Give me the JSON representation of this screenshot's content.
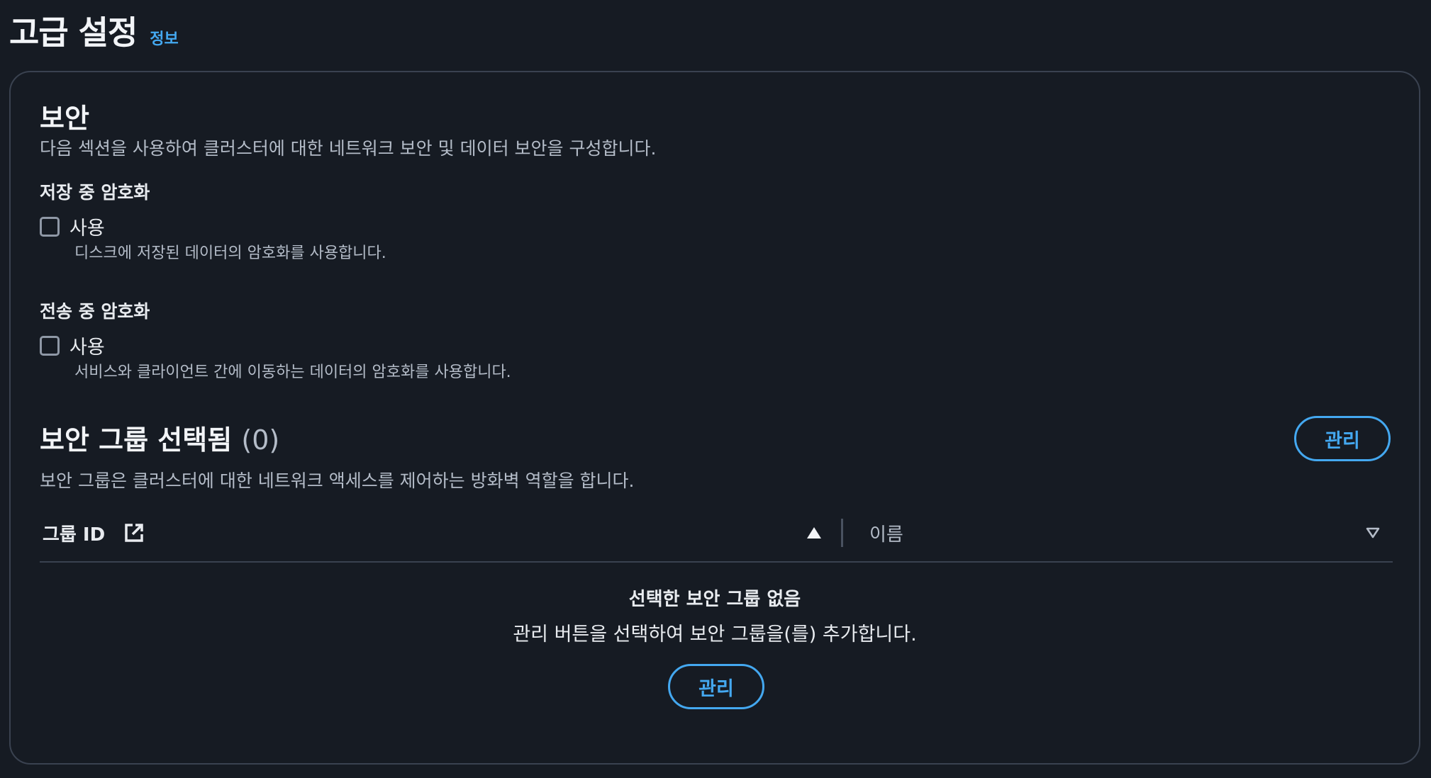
{
  "header": {
    "title": "고급 설정",
    "info_link": "정보"
  },
  "security": {
    "title": "보안",
    "description": "다음 섹션을 사용하여 클러스터에 대한 네트워크 보안 및 데이터 보안을 구성합니다.",
    "encryption_at_rest": {
      "label": "저장 중 암호화",
      "checkbox_label": "사용",
      "checked": false,
      "description": "디스크에 저장된 데이터의 암호화를 사용합니다."
    },
    "encryption_in_transit": {
      "label": "전송 중 암호화",
      "checkbox_label": "사용",
      "checked": false,
      "description": "서비스와 클라이언트 간에 이동하는 데이터의 암호화를 사용합니다."
    }
  },
  "security_groups": {
    "title": "보안 그룹 선택됨",
    "count": "(0)",
    "description": "보안 그룹은 클러스터에 대한 네트워크 액세스를 제어하는 방화벽 역할을 합니다.",
    "manage_button": "관리",
    "table": {
      "columns": [
        "그룹 ID",
        "이름"
      ]
    },
    "empty_state": {
      "title": "선택한 보안 그룹 없음",
      "description": "관리 버튼을 선택하여 보안 그룹을(를) 추가합니다.",
      "button": "관리"
    }
  },
  "icons": {
    "external_link": "external-link-icon",
    "sort_ascending": "sort-ascending-icon",
    "sort_descending": "sort-descending-icon"
  },
  "colors": {
    "background": "#161b23",
    "accent": "#44a8f0",
    "border": "#3a4250"
  }
}
